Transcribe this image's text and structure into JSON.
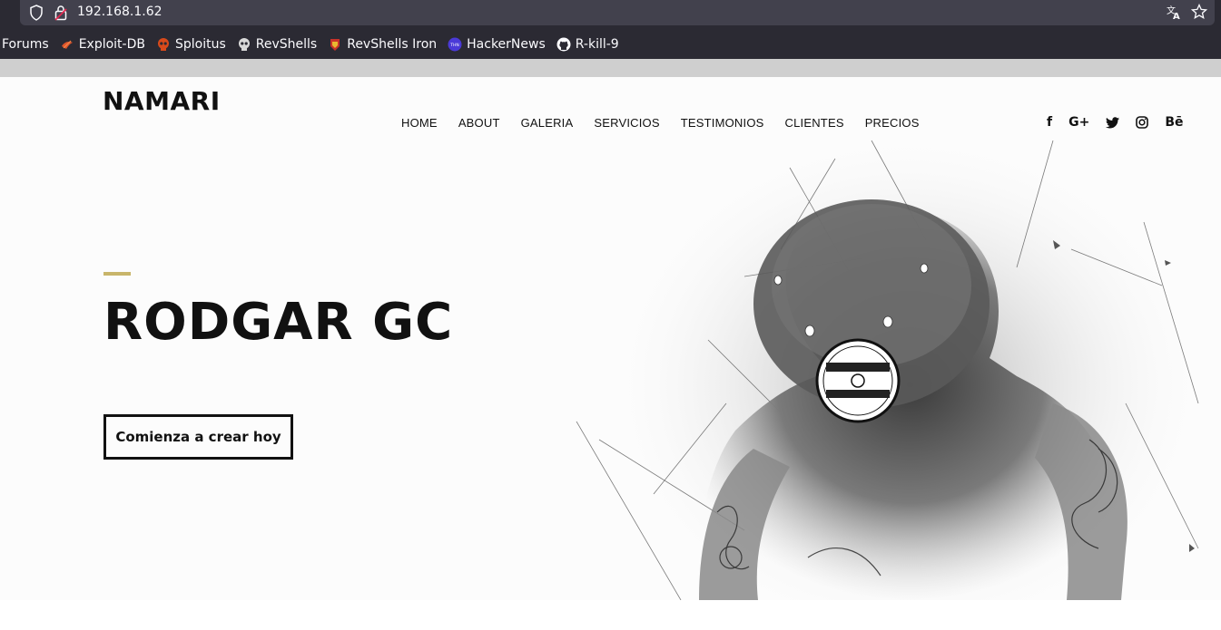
{
  "browser": {
    "url": "192.168.1.62",
    "icons": [
      "shield-icon",
      "lock-warning-icon",
      "translate-icon",
      "star-icon"
    ],
    "bookmarks": [
      {
        "label": "Forums",
        "icon": ""
      },
      {
        "label": "Exploit-DB",
        "icon": "exploitdb-icon"
      },
      {
        "label": "Sploitus",
        "icon": "skull-icon"
      },
      {
        "label": "RevShells",
        "icon": "skull-icon"
      },
      {
        "label": "RevShells Iron",
        "icon": "ironman-icon"
      },
      {
        "label": "HackerNews",
        "icon": "thn-icon"
      },
      {
        "label": "R-kill-9",
        "icon": "github-icon"
      }
    ]
  },
  "site": {
    "logo": "NAMARI",
    "nav": [
      "HOME",
      "ABOUT",
      "GALERIA",
      "SERVICIOS",
      "TESTIMONIOS",
      "CLIENTES",
      "PRECIOS"
    ],
    "social": [
      {
        "name": "facebook-icon",
        "glyph": "f"
      },
      {
        "name": "google-plus-icon",
        "glyph": "G+"
      },
      {
        "name": "twitter-icon",
        "glyph": ""
      },
      {
        "name": "instagram-icon",
        "glyph": ""
      },
      {
        "name": "behance-icon",
        "glyph": "Bē"
      }
    ],
    "accent_color": "#c8b56a",
    "hero": {
      "title": "RODGAR GC",
      "cta_label": "Comienza a crear hoy"
    }
  }
}
